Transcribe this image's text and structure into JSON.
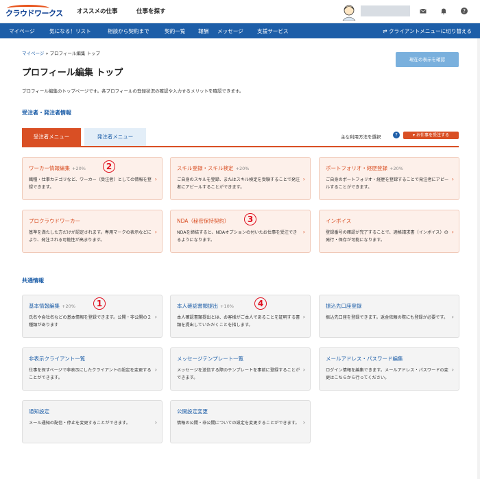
{
  "header": {
    "logo": "クラウドワークス",
    "nav": [
      "オススメの仕事",
      "仕事を探す"
    ]
  },
  "navbar": {
    "items": [
      "マイページ",
      "気になる！リスト",
      "相談から契約まで",
      "契約一覧",
      "報酬",
      "メッセージ",
      "支援サービス"
    ],
    "switch_label": "クライアントメニューに切り替える"
  },
  "breadcrumb": {
    "home": "マイページ",
    "sep": "»",
    "current": "プロフィール編集 トップ"
  },
  "page": {
    "title": "プロフィール編集 トップ",
    "confirm_button": "現在の表示を確認",
    "description": "プロフィール編集のトップページです。各プロフィールの登録状況の確認や入力するメリットを確認できます。"
  },
  "section1": {
    "title": "受注者・発注者情報",
    "tab_active": "受注者メニュー",
    "tab_inactive": "発注者メニュー",
    "usage_label": "主な利用方法を選択",
    "usage_value": "お仕事を受注する"
  },
  "cards_worker": [
    {
      "title": "ワーカー情報編集",
      "pct": "+20%",
      "desc": "職種・仕事カテゴリなど、ワーカー（受注者）としての情報を登録できます。"
    },
    {
      "title": "スキル登録・スキル検定",
      "pct": "+20%",
      "desc": "ご自身のスキルを登録、またはスキル検定を受験することで発注者にアピールすることができます。"
    },
    {
      "title": "ポートフォリオ・経歴登録",
      "pct": "+20%",
      "desc": "ご自身のポートフォリオ・経歴を登録することで発注者にアピールすることができます。"
    },
    {
      "title": "プロクラウドワーカー",
      "pct": "",
      "desc": "基準を満たした方だけが認定されます。専用マークの表示などにより、発注される可能性が高まります。"
    },
    {
      "title": "NDA（秘密保持契約）",
      "pct": "",
      "desc": "NDAを締結すると、NDAオプションの付いたお仕事を受注できるようになります。"
    },
    {
      "title": "インボイス",
      "pct": "",
      "desc": "登録番号の確認が完了することで、適格請求書（インボイス）の発行・保存が可能になります。"
    }
  ],
  "section2": {
    "title": "共通情報"
  },
  "cards_common": [
    {
      "title": "基本情報編集",
      "pct": "+20%",
      "desc": "氏名や会社名などの基本情報を登録できます。公開・非公開の２種類があります"
    },
    {
      "title": "本人確認書類提出",
      "pct": "+10%",
      "desc": "本人確認書類提出とは、お客様がご本人であることを証明する書類を提出していただくことを指します。"
    },
    {
      "title": "振込先口座登録",
      "pct": "",
      "desc": "振込先口座を登録できます。返金依頼の際にも登録が必要です。"
    },
    {
      "title": "非表示クライアント一覧",
      "pct": "",
      "desc": "仕事を探すページで非表示にしたクライアントの設定を変更することができます。"
    },
    {
      "title": "メッセージテンプレート一覧",
      "pct": "",
      "desc": "メッセージを送信する際のテンプレートを事前に登録することができます。"
    },
    {
      "title": "メールアドレス・パスワード編集",
      "pct": "",
      "desc": "ログイン情報を編集できます。メールアドレス・パスワードの変更はこちらから行ってください。"
    },
    {
      "title": "通知設定",
      "pct": "",
      "desc": "メール通知の配信・停止を変更することができます。"
    },
    {
      "title": "公開設定変更",
      "pct": "",
      "desc": "情報の公開・非公開についての設定を変更することができます。"
    }
  ],
  "annotations": [
    "1",
    "2",
    "3",
    "4"
  ],
  "chevron": "›"
}
